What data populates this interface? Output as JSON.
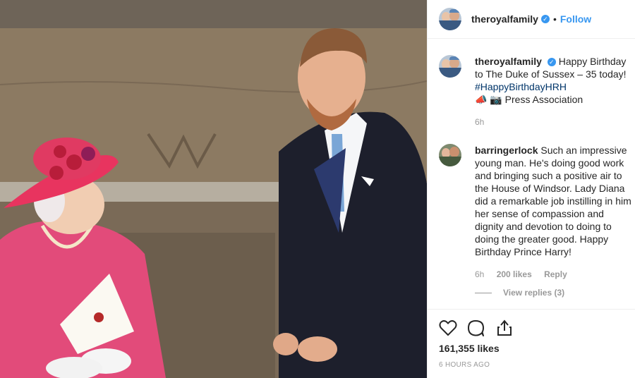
{
  "header": {
    "username": "theroyalfamily",
    "verified_mark": "✓",
    "separator": "•",
    "follow_label": "Follow"
  },
  "caption": {
    "username": "theroyalfamily",
    "text": "Happy Birthday to The Duke of Sussex – 35 today!",
    "hashtag": "#HappyBirthdayHRH",
    "credit": "Press Association",
    "credit_icons": "📣 📷",
    "time": "6h"
  },
  "comment": {
    "username": "barringerlock",
    "text": "Such an impressive young man. He's doing good work and bringing such a positive air to the House of Windsor. Lady Diana did a remarkable job instilling in him her sense of compassion and dignity and devotion to doing to doing the greater good. Happy Birthday Prince Harry!",
    "time": "6h",
    "likes": "200 likes",
    "reply_label": "Reply",
    "view_replies": "View replies (3)"
  },
  "actions": {
    "icons": [
      "heart-icon",
      "comment-icon",
      "share-icon"
    ],
    "likes": "161,355 likes",
    "timestamp": "6 HOURS AGO"
  },
  "colors": {
    "link": "#3897f0",
    "hashtag": "#003569",
    "muted": "#999999"
  }
}
